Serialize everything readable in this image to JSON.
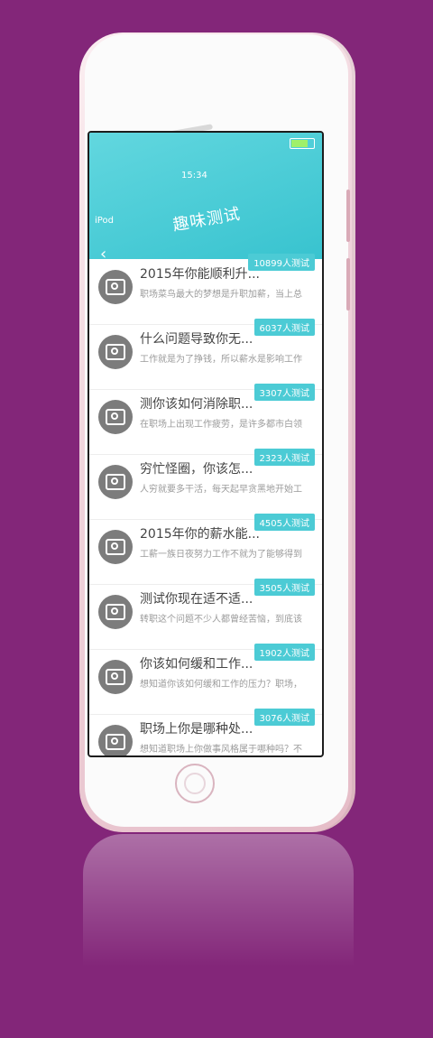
{
  "status": {
    "carrier": "iPod",
    "time": "15:34",
    "battery_level": 0.8
  },
  "header": {
    "title": "趣味测试",
    "back_icon": "chevron-left-icon"
  },
  "items": [
    {
      "title": "2015年你能顺利升...",
      "desc": "职场菜鸟最大的梦想是升职加薪，当上总",
      "badge": "10899人测试"
    },
    {
      "title": "什么问题导致你无...",
      "desc": "工作就是为了挣钱，所以薪水是影响工作",
      "badge": "6037人测试"
    },
    {
      "title": "测你该如何消除职...",
      "desc": "在职场上出现工作疲劳，是许多都市白领",
      "badge": "3307人测试"
    },
    {
      "title": "穷忙怪圈，你该怎...",
      "desc": "人穷就要多干活，每天起早贪黑地开始工",
      "badge": "2323人测试"
    },
    {
      "title": "2015年你的薪水能...",
      "desc": "工薪一族日夜努力工作不就为了能够得到",
      "badge": "4505人测试"
    },
    {
      "title": "测试你现在适不适...",
      "desc": "转职这个问题不少人都曾经苦恼，到底该",
      "badge": "3505人测试"
    },
    {
      "title": "你该如何缓和工作...",
      "desc": "想知道你该如何缓和工作的压力？职场，",
      "badge": "1902人测试"
    },
    {
      "title": "职场上你是哪种处...",
      "desc": "想知道职场上你做事风格属于哪种吗？不",
      "badge": "3076人测试"
    }
  ],
  "home_button_label": "home-button",
  "colors": {
    "background": "#832679",
    "accent": "#38c3cf",
    "badge": "#4ccbd5"
  }
}
